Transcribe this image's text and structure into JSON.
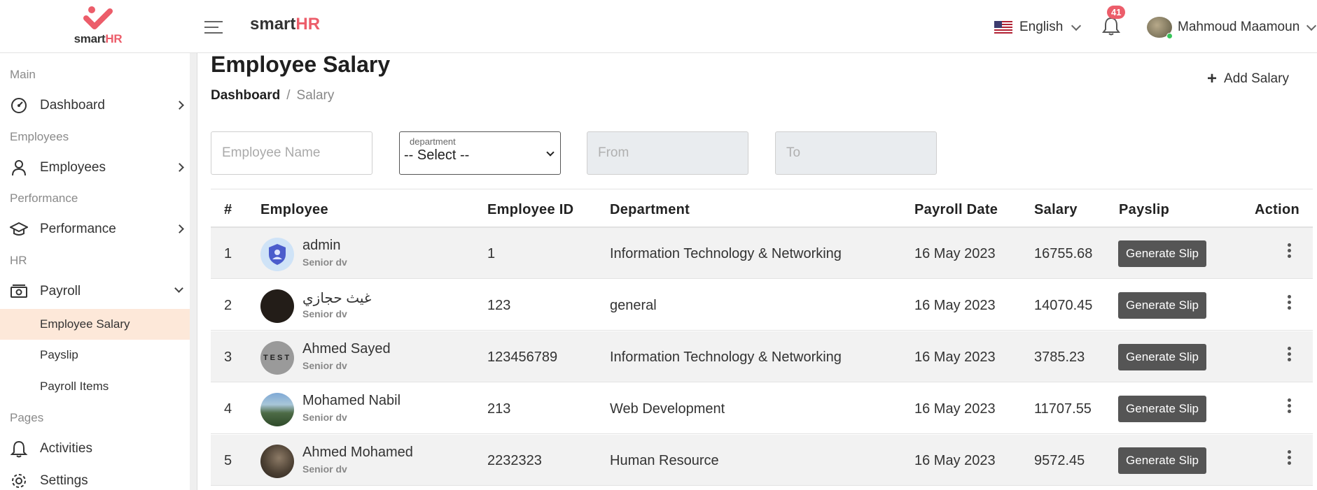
{
  "header": {
    "logo_text_a": "smart",
    "logo_text_b": "HR",
    "brand_a": "smart",
    "brand_b": "HR",
    "language": "English",
    "notifications_count": "41",
    "user_name": "Mahmoud Maamoun"
  },
  "sidebar": {
    "sections": {
      "main": "Main",
      "employees": "Employees",
      "performance": "Performance",
      "hr": "HR",
      "pages": "Pages"
    },
    "items": {
      "dashboard": "Dashboard",
      "employees": "Employees",
      "performance": "Performance",
      "payroll": "Payroll",
      "employee_salary": "Employee Salary",
      "payslip": "Payslip",
      "payroll_items": "Payroll Items",
      "activities": "Activities",
      "settings": "Settings"
    }
  },
  "page": {
    "title": "Employee Salary",
    "breadcrumb_home": "Dashboard",
    "breadcrumb_sep": "/",
    "breadcrumb_current": "Salary",
    "add_button": "Add Salary"
  },
  "filters": {
    "employee_name_placeholder": "Employee Name",
    "department_label": "department",
    "department_value": "-- Select --",
    "from_placeholder": "From",
    "to_placeholder": "To"
  },
  "table": {
    "headers": [
      "#",
      "Employee",
      "Employee ID",
      "Department",
      "Payroll Date",
      "Salary",
      "Payslip",
      "Action"
    ],
    "rows": [
      {
        "num": "1",
        "name": "admin",
        "role": "Senior dv",
        "id": "1",
        "department": "Information Technology & Networking",
        "date": "16 May 2023",
        "salary": "16755.68",
        "button": "Generate Slip"
      },
      {
        "num": "2",
        "name": "غيث حجازي",
        "role": "Senior dv",
        "id": "123",
        "department": "general",
        "date": "16 May 2023",
        "salary": "14070.45",
        "button": "Generate Slip"
      },
      {
        "num": "3",
        "name": "Ahmed Sayed",
        "role": "Senior dv",
        "id": "123456789",
        "department": "Information Technology & Networking",
        "date": "16 May 2023",
        "salary": "3785.23",
        "button": "Generate Slip"
      },
      {
        "num": "4",
        "name": "Mohamed Nabil",
        "role": "Senior dv",
        "id": "213",
        "department": "Web Development",
        "date": "16 May 2023",
        "salary": "11707.55",
        "button": "Generate Slip"
      },
      {
        "num": "5",
        "name": "Ahmed Mohamed",
        "role": "Senior dv",
        "id": "2232323",
        "department": "Human Resource",
        "date": "16 May 2023",
        "salary": "9572.45",
        "button": "Generate Slip"
      }
    ]
  },
  "avatar_test_text": "TEST",
  "colors": {
    "brand_accent": "#ec5d6a",
    "active_item_bg": "#fde8d9",
    "slip_button_bg": "#555555",
    "online_dot": "#37c55a"
  }
}
